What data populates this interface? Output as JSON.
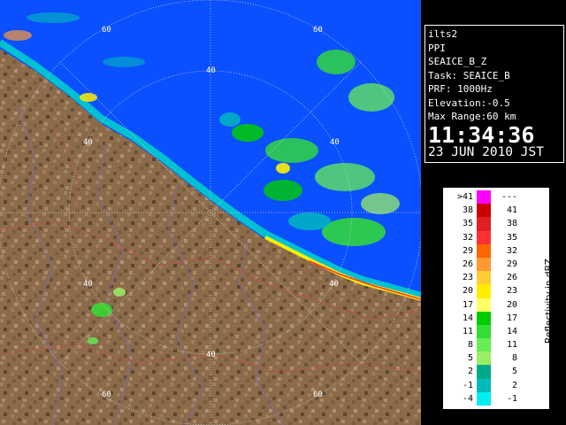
{
  "radar_info": {
    "system": "ilts2",
    "scan": "PPI",
    "product": "SEAICE_B_Z",
    "task": "Task: SEAICE_B",
    "prf": "PRF: 1000Hz",
    "elevation": "Elevation:-0.5",
    "max_range": "Max Range:60 km",
    "time": "11:34:36",
    "date": "23 JUN 2010 JST"
  },
  "range_rings": {
    "labels": [
      "60",
      "60",
      "40",
      "40",
      "40",
      "40",
      "40",
      "40",
      "60",
      "60"
    ]
  },
  "legend": {
    "unit_label": "Reflectivity in dBZ",
    "bins": [
      {
        "low": ">41",
        "high": "---",
        "color": "#ff00ff"
      },
      {
        "low": "38",
        "high": "41",
        "color": "#cc0000"
      },
      {
        "low": "35",
        "high": "38",
        "color": "#e02020"
      },
      {
        "low": "32",
        "high": "35",
        "color": "#ff3030"
      },
      {
        "low": "29",
        "high": "32",
        "color": "#ff6600"
      },
      {
        "low": "26",
        "high": "29",
        "color": "#ff9933"
      },
      {
        "low": "23",
        "high": "26",
        "color": "#ffcc33"
      },
      {
        "low": "20",
        "high": "23",
        "color": "#ffee00"
      },
      {
        "low": "17",
        "high": "20",
        "color": "#ffff66"
      },
      {
        "low": "14",
        "high": "17",
        "color": "#00cc00"
      },
      {
        "low": "11",
        "high": "14",
        "color": "#33dd33"
      },
      {
        "low": "8",
        "high": "11",
        "color": "#66ee55"
      },
      {
        "low": "5",
        "high": "8",
        "color": "#99ee66"
      },
      {
        "low": "2",
        "high": "5",
        "color": "#00aa88"
      },
      {
        "low": "-1",
        "high": "2",
        "color": "#00bbbb"
      },
      {
        "low": "-4",
        "high": "-1",
        "color": "#00eeee"
      }
    ]
  },
  "colors": {
    "sea": "#0a50ff",
    "land": "#8a6a48",
    "background": "#000000"
  }
}
